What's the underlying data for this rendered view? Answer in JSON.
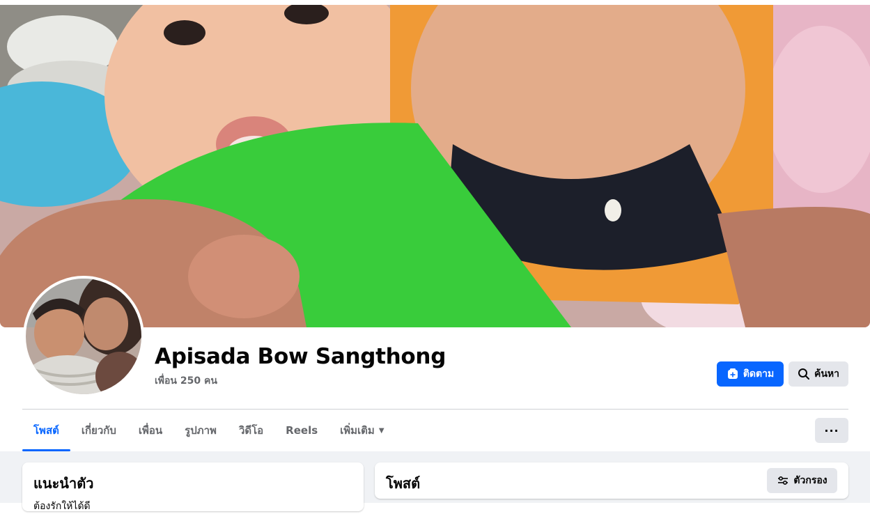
{
  "profile": {
    "name": "Apisada Bow Sangthong",
    "friends": "เพื่อน 250 คน"
  },
  "actions": {
    "follow_label": "ติดตาม",
    "search_label": "ค้นหา",
    "more_label": "···"
  },
  "tabs": [
    {
      "label": "โพสต์",
      "active": true
    },
    {
      "label": "เกี่ยวกับ",
      "active": false
    },
    {
      "label": "เพื่อน",
      "active": false
    },
    {
      "label": "รูปภาพ",
      "active": false
    },
    {
      "label": "วิดีโอ",
      "active": false
    },
    {
      "label": "Reels",
      "active": false
    },
    {
      "label": "เพิ่มเติม",
      "active": false
    }
  ],
  "intro": {
    "title": "แนะนำตัว",
    "line": "ต้องรักให้ได้ดี"
  },
  "posts": {
    "title": "โพสต์",
    "filter_label": "ตัวกรอง"
  },
  "colors": {
    "accent": "#0866ff",
    "secondary_button": "#e4e6eb",
    "page_bg": "#f0f2f5",
    "muted_text": "#65676b"
  },
  "icons": {
    "follow": "follow-plus-icon",
    "search": "search-icon",
    "filter": "filter-icon",
    "more_tab": "dropdown-arrow-icon"
  }
}
